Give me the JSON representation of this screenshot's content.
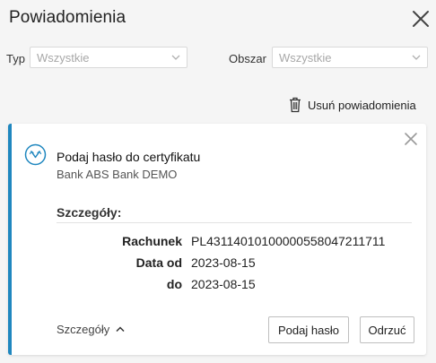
{
  "header": {
    "title": "Powiadomienia",
    "close_icon": "close-icon"
  },
  "filters": {
    "type": {
      "label": "Typ",
      "value": "Wszystkie"
    },
    "area": {
      "label": "Obszar",
      "value": "Wszystkie"
    }
  },
  "actions": {
    "remove_all_label": "Usuń powiadomienia",
    "remove_icon": "trash-icon"
  },
  "notification": {
    "icon": "signature-icon",
    "accent_color": "#1f87bf",
    "title": "Podaj hasło do certyfikatu",
    "subtitle": "Bank ABS Bank DEMO",
    "details_heading": "Szczegóły:",
    "details": [
      {
        "key": "Rachunek",
        "value": "PL43114010100000558047211711"
      },
      {
        "key": "Data od",
        "value": "2023-08-15"
      },
      {
        "key": "do",
        "value": "2023-08-15"
      }
    ],
    "toggle_label": "Szczegóły",
    "primary_button": "Podaj hasło",
    "reject_button": "Odrzuć"
  }
}
